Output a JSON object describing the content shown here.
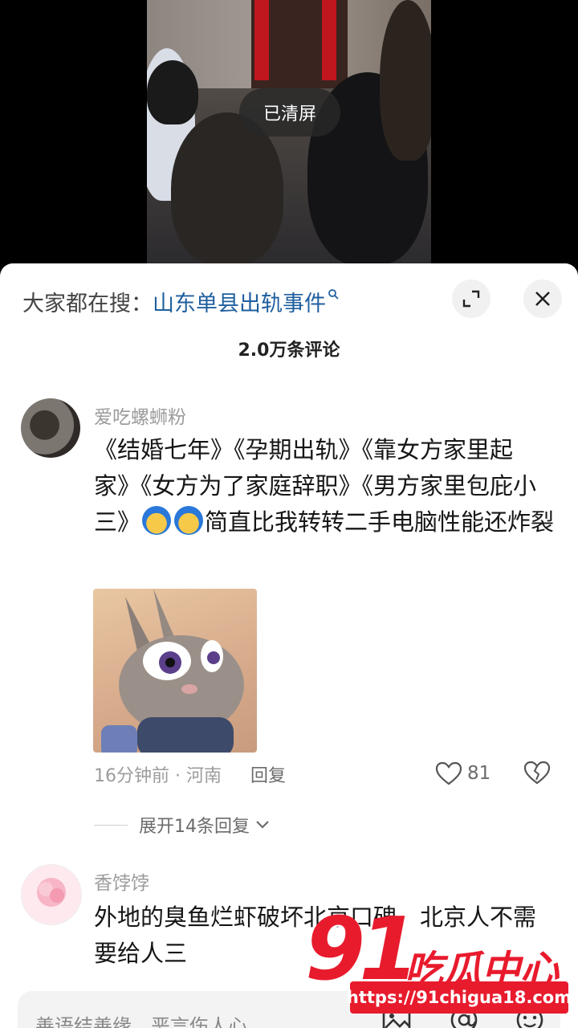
{
  "video": {
    "overlay_label": "已清屏"
  },
  "sheet": {
    "search": {
      "prefix": "大家都在搜：",
      "term": "山东单县出轨事件",
      "term_icon": "search-icon"
    },
    "expand_icon": "expand-icon",
    "close_icon": "close-icon",
    "comment_count_title": "2.0万条评论"
  },
  "comments": [
    {
      "username": "爱吃螺蛳粉",
      "text_part1": "《结婚七年》《孕期出轨》《靠女方家里起家》《女方为了家庭辞职》《男方家里包庇小三》",
      "emojis": [
        "face-emoji",
        "face-emoji"
      ],
      "text_part2": "简直比我转转二手电脑性能还炸裂",
      "image_icon": "rabbit-sticker",
      "time_location": "16分钟前 · 河南",
      "reply_label": "回复",
      "likes": "81",
      "expand_label": "展开14条回复"
    },
    {
      "username": "香饽饽",
      "text": "外地的臭鱼烂虾破坏北京口碑，北京人不需要给人三"
    }
  ],
  "input_bar": {
    "placeholder": "善语结善缘，恶言伤人心",
    "icons": [
      "image-icon",
      "at-icon",
      "emoji-icon"
    ]
  },
  "watermark": {
    "number": "91",
    "name": "吃瓜中心",
    "url": "https://91chigua18.com"
  }
}
